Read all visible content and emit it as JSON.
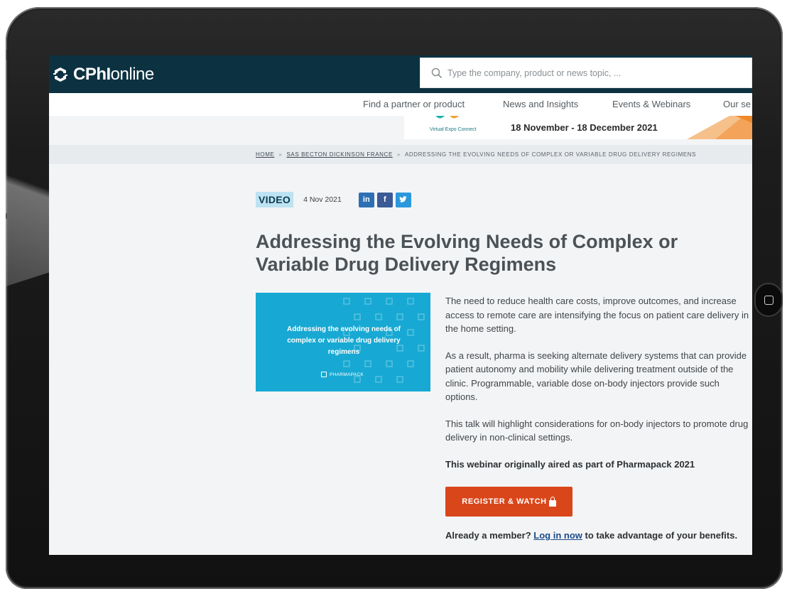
{
  "logo": {
    "brand_bold": "CPhI",
    "brand_light": "online"
  },
  "search": {
    "placeholder": "Type the company, product or news topic, ..."
  },
  "nav": {
    "items": [
      "Find a partner or product",
      "News and Insights",
      "Events & Webinars",
      "Our se"
    ]
  },
  "banner": {
    "sub_label": "Virtual Expo Connect",
    "dates": "18 November - 18 December 2021"
  },
  "breadcrumb": {
    "home": "HOME",
    "company": "SAS BECTON DICKINSON FRANCE",
    "current": "ADDRESSING THE EVOLVING NEEDS OF COMPLEX OR VARIABLE DRUG DELIVERY REGIMENS",
    "separator": "»"
  },
  "article": {
    "tag": "VIDEO",
    "date": "4 Nov 2021",
    "share": {
      "linkedin": "in",
      "facebook": "f"
    },
    "title": "Addressing the Evolving Needs of Complex or Variable Drug Delivery Regimens",
    "thumbnail": {
      "text": "Addressing the evolving needs of complex or variable drug delivery regimens",
      "brand": "PHARMAPACK"
    },
    "paragraphs": [
      "The need to reduce health care costs, improve outcomes, and increase access to remote care are intensifying the focus on patient care delivery in the home setting.",
      "As a result, pharma is seeking alternate delivery systems that can provide patient autonomy and mobility while delivering treatment outside of the clinic. Programmable, variable dose on-body injectors provide such options.",
      "This talk will highlight considerations for on-body injectors to promote drug delivery in non-clinical settings."
    ],
    "aired_note": "This webinar originally aired as part of Pharmapack 2021",
    "register_label": "REGISTER & WATCH",
    "member": {
      "prefix": "Already a member?",
      "link": "Log in now",
      "suffix": "to take advantage of your benefits."
    }
  },
  "colors": {
    "header": "#0c3242",
    "accent": "#d9461a",
    "tag_bg": "#bde3f2",
    "thumb_bg": "#17a9d3"
  }
}
